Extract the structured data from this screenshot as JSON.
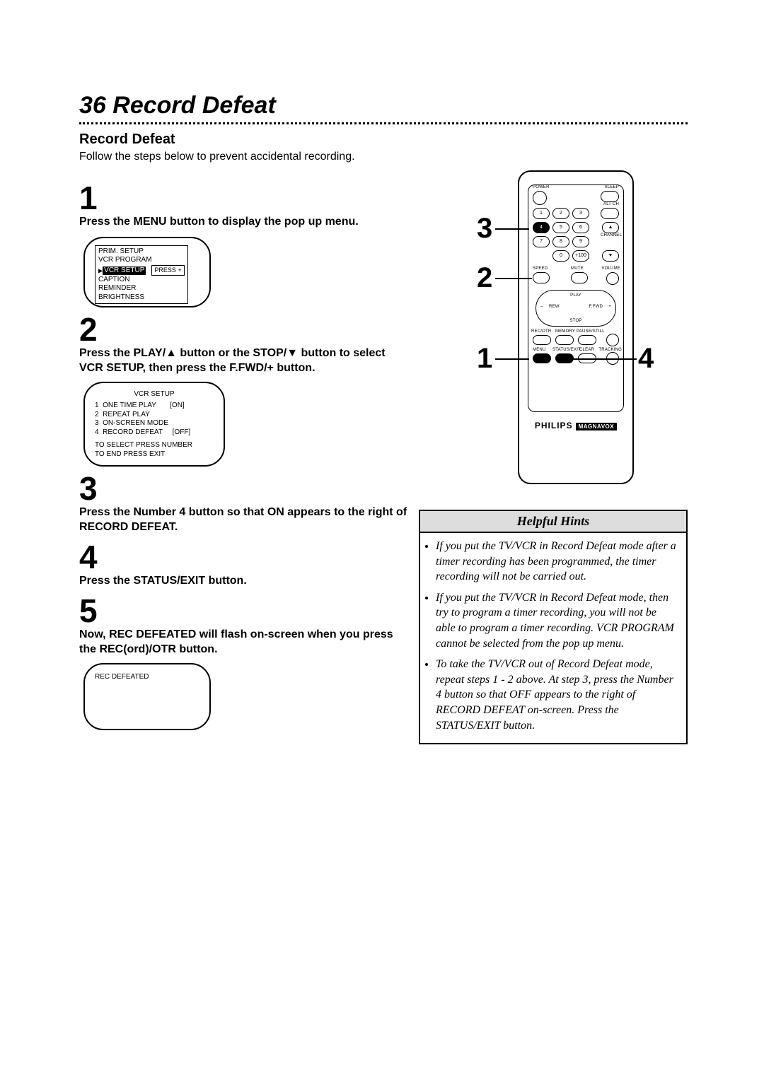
{
  "page": {
    "number_title": "36 Record Defeat",
    "heading": "Record Defeat",
    "intro": "Follow the steps below to prevent accidental recording."
  },
  "steps": {
    "s1": {
      "num": "1",
      "text": "Press the MENU button to display the pop up menu."
    },
    "s2": {
      "num": "2",
      "text": "Press the PLAY/▲ button or the STOP/▼ button to select VCR SETUP, then press the F.FWD/+ button."
    },
    "s3": {
      "num": "3",
      "text": "Press the Number 4 button so that ON appears to the right of RECORD DEFEAT."
    },
    "s4": {
      "num": "4",
      "text": "Press the STATUS/EXIT button."
    },
    "s5": {
      "num": "5",
      "text": "Now, REC DEFEATED will flash on-screen when you press the REC(ord)/OTR button."
    }
  },
  "tv1": {
    "l1": "PRIM. SETUP",
    "l2": "VCR PROGRAM",
    "l3": "VCR SETUP",
    "l4": "CAPTION",
    "l5": "REMINDER",
    "l6": "BRIGHTNESS",
    "plus": "PRESS +"
  },
  "tv2": {
    "title": "VCR SETUP",
    "r1": "1  ONE TIME PLAY       [ON]",
    "r2": "2  REPEAT PLAY",
    "r3": "3  ON-SCREEN MODE",
    "r4": "4  RECORD DEFEAT     [OFF]",
    "f1": "TO SELECT PRESS NUMBER",
    "f2": "TO END PRESS EXIT"
  },
  "tv3": {
    "line": "REC DEFEATED"
  },
  "remote": {
    "power": "POWER",
    "sleep": "SLEEP",
    "altch": "ALT CH",
    "b1": "1",
    "b2": "2",
    "b3": "3",
    "b4": "4",
    "b5": "5",
    "b6": "6",
    "b7": "7",
    "b8": "8",
    "b9": "9",
    "b0": "0",
    "b100": "+100",
    "chup": "▲",
    "chdn": "▼",
    "channel": "CHANNEL",
    "speed": "SPEED",
    "mute": "MUTE",
    "volume": "VOLUME",
    "play": "PLAY",
    "rew": "REW",
    "ffwd": "F.FWD",
    "stop": "STOP",
    "minus": "–",
    "plus": "+",
    "recotr": "REC/OTR",
    "memory": "MEMORY",
    "pausestill": "PAUSE/STILL",
    "menu": "MENU",
    "statusexit": "STATUS/EXIT",
    "reset": "CLEAR",
    "tracking": "TRACKING",
    "brand": "PHILIPS",
    "brand2": "MAGNAVOX"
  },
  "callouts": {
    "c1": "1",
    "c2": "2",
    "c3": "3",
    "c4": "4"
  },
  "hints": {
    "title": "Helpful Hints",
    "h1": "If you put the TV/VCR in Record Defeat mode after a timer recording has been programmed, the timer recording will not be carried out.",
    "h2": "If you put the TV/VCR in Record Defeat mode, then try to program a timer recording, you will not be able to program a timer recording.  VCR PROGRAM cannot be selected from the pop up menu.",
    "h3": "To take the TV/VCR out of Record Defeat mode, repeat steps 1 - 2 above.  At step 3, press the Number 4 button so that OFF appears to the right of RECORD DEFEAT on-screen. Press the STATUS/EXIT button."
  }
}
